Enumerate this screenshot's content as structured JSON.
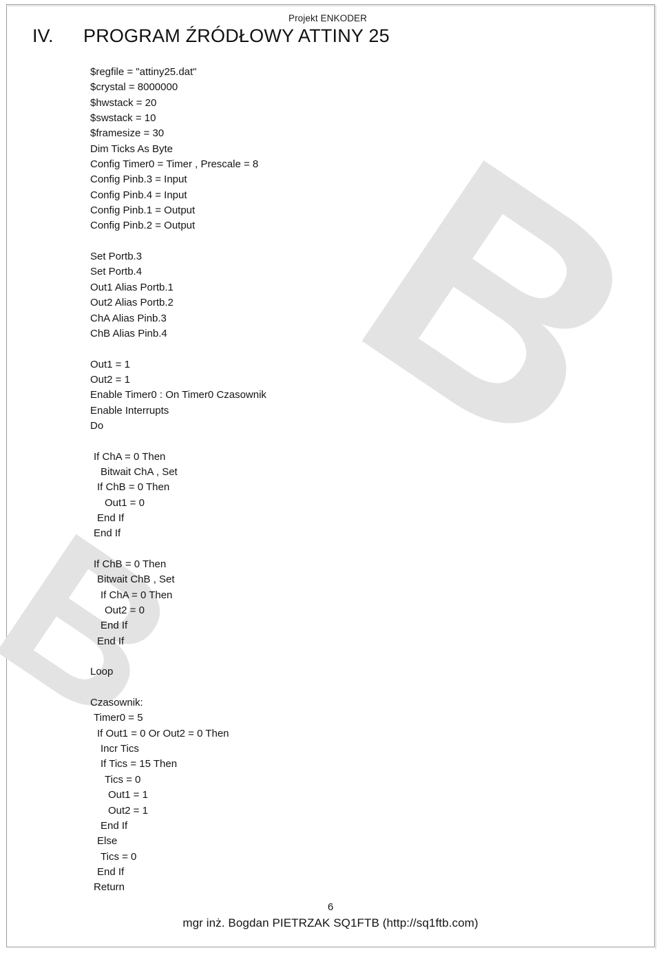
{
  "header": {
    "project_label": "Projekt ENKODER"
  },
  "title": {
    "number": "IV.",
    "text": "PROGRAM ŹRÓDŁOWY ATTINY 25"
  },
  "code": {
    "language": "BASCOM-AVR",
    "lines": [
      {
        "indent": 0,
        "text": "$regfile = \"attiny25.dat\""
      },
      {
        "indent": 0,
        "text": "$crystal = 8000000"
      },
      {
        "indent": 0,
        "text": "$hwstack = 20"
      },
      {
        "indent": 0,
        "text": "$swstack = 10"
      },
      {
        "indent": 0,
        "text": "$framesize = 30"
      },
      {
        "indent": 0,
        "text": "Dim Ticks As Byte"
      },
      {
        "indent": 0,
        "text": "Config Timer0 = Timer , Prescale = 8"
      },
      {
        "indent": 0,
        "text": "Config Pinb.3 = Input"
      },
      {
        "indent": 0,
        "text": "Config Pinb.4 = Input"
      },
      {
        "indent": 0,
        "text": "Config Pinb.1 = Output"
      },
      {
        "indent": 0,
        "text": "Config Pinb.2 = Output"
      },
      {
        "indent": 0,
        "text": ""
      },
      {
        "indent": 0,
        "text": "Set Portb.3"
      },
      {
        "indent": 0,
        "text": "Set Portb.4"
      },
      {
        "indent": 0,
        "text": "Out1 Alias Portb.1"
      },
      {
        "indent": 0,
        "text": "Out2 Alias Portb.2"
      },
      {
        "indent": 0,
        "text": "ChA Alias Pinb.3"
      },
      {
        "indent": 0,
        "text": "ChB Alias Pinb.4"
      },
      {
        "indent": 0,
        "text": ""
      },
      {
        "indent": 0,
        "text": "Out1 = 1"
      },
      {
        "indent": 0,
        "text": "Out2 = 1"
      },
      {
        "indent": 0,
        "text": "Enable Timer0 : On Timer0 Czasownik"
      },
      {
        "indent": 0,
        "text": "Enable Interrupts"
      },
      {
        "indent": 0,
        "text": "Do"
      },
      {
        "indent": 0,
        "text": ""
      },
      {
        "indent": 1,
        "text": "If ChA = 0 Then"
      },
      {
        "indent": 3,
        "text": "Bitwait ChA , Set"
      },
      {
        "indent": 2,
        "text": "If ChB = 0 Then"
      },
      {
        "indent": 4,
        "text": "Out1 = 0"
      },
      {
        "indent": 2,
        "text": "End If"
      },
      {
        "indent": 1,
        "text": "End If"
      },
      {
        "indent": 0,
        "text": ""
      },
      {
        "indent": 1,
        "text": "If ChB = 0 Then"
      },
      {
        "indent": 2,
        "text": "Bitwait ChB , Set"
      },
      {
        "indent": 3,
        "text": "If ChA = 0 Then"
      },
      {
        "indent": 4,
        "text": "Out2 = 0"
      },
      {
        "indent": 3,
        "text": "End If"
      },
      {
        "indent": 2,
        "text": "End If"
      },
      {
        "indent": 0,
        "text": ""
      },
      {
        "indent": 0,
        "text": "Loop"
      },
      {
        "indent": 0,
        "text": ""
      },
      {
        "indent": 0,
        "text": "Czasownik:"
      },
      {
        "indent": 1,
        "text": "Timer0 = 5"
      },
      {
        "indent": 2,
        "text": "If Out1 = 0 Or Out2 = 0 Then"
      },
      {
        "indent": 3,
        "text": "Incr Tics"
      },
      {
        "indent": 3,
        "text": "If Tics = 15 Then"
      },
      {
        "indent": 4,
        "text": "Tics = 0"
      },
      {
        "indent": 5,
        "text": "Out1 = 1"
      },
      {
        "indent": 5,
        "text": "Out2 = 1"
      },
      {
        "indent": 3,
        "text": "End If"
      },
      {
        "indent": 2,
        "text": "Else"
      },
      {
        "indent": 3,
        "text": "Tics = 0"
      },
      {
        "indent": 2,
        "text": "End If"
      },
      {
        "indent": 1,
        "text": "Return"
      }
    ]
  },
  "footer": {
    "page_number": "6",
    "credit": "mgr inż. Bogdan PIETRZAK SQ1FTB (http://sq1ftb.com)"
  },
  "watermarks": {
    "main_glyph": "B",
    "left_glyph": "B",
    "color": "#e3e3e3"
  }
}
